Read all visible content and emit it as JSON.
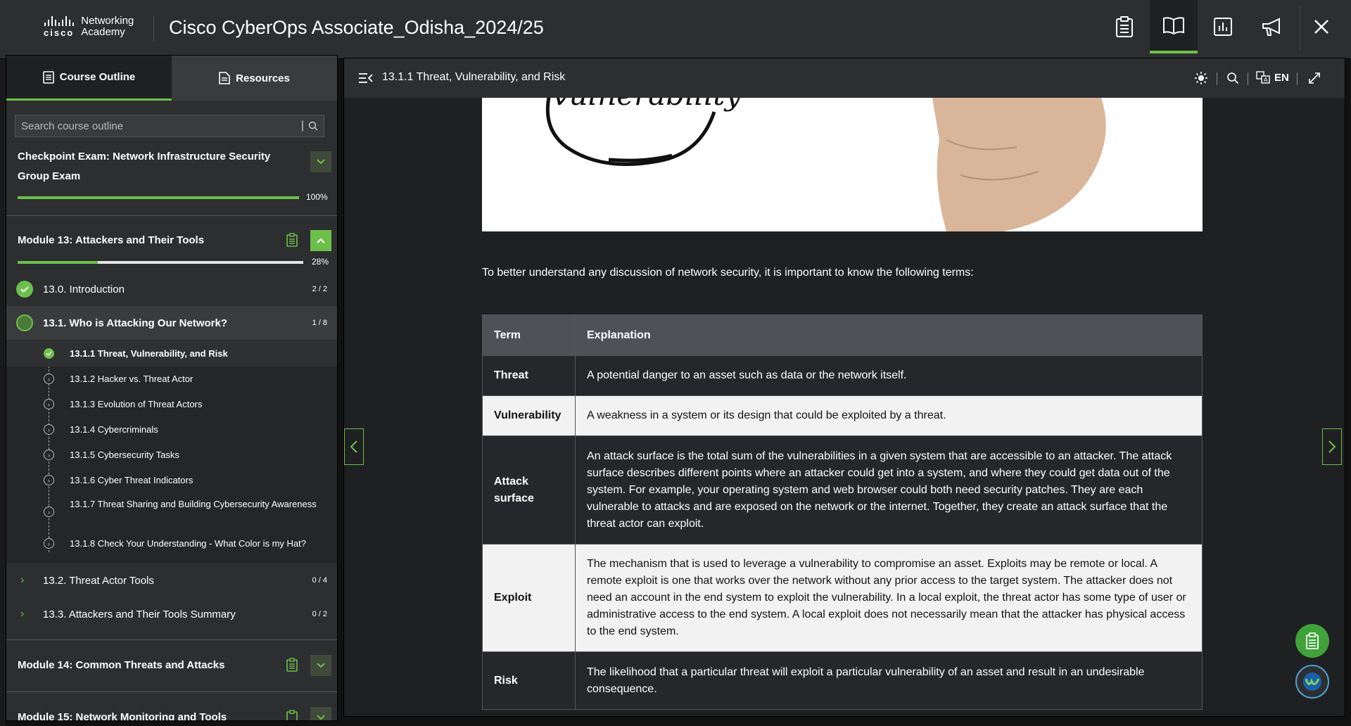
{
  "header": {
    "logo_brand": "cisco",
    "logo_line1": "Networking",
    "logo_line2": "Academy",
    "title": "Cisco CyberOps Associate_Odisha_2024/25",
    "buttons": [
      "clipboard-icon",
      "book-icon",
      "chart-icon",
      "megaphone-icon",
      "close-icon"
    ]
  },
  "sidebar": {
    "tabs": [
      {
        "label": "Course Outline",
        "active": true
      },
      {
        "label": "Resources",
        "active": false
      }
    ],
    "search_placeholder": "Search course outline",
    "exam": {
      "title": "Checkpoint Exam: Network Infrastructure Security Group Exam",
      "progress": 1.0,
      "progress_label": "100%"
    },
    "module13": {
      "title": "Module 13: Attackers and Their Tools",
      "progress": 0.28,
      "progress_label": "28%"
    },
    "topics": [
      {
        "label": "13.0. Introduction",
        "count": "2 / 2",
        "status": "done"
      },
      {
        "label": "13.1. Who is Attacking Our Network?",
        "count": "1 / 8",
        "status": "in-progress"
      },
      {
        "label": "13.2. Threat Actor Tools",
        "count": "0 / 4",
        "status": "collapsed"
      },
      {
        "label": "13.3. Attackers and Their Tools Summary",
        "count": "0 / 2",
        "status": "collapsed"
      }
    ],
    "subtopics": [
      {
        "label": "13.1.1 Threat, Vulnerability, and Risk",
        "done": true
      },
      {
        "label": "13.1.2 Hacker vs. Threat Actor",
        "done": false
      },
      {
        "label": "13.1.3 Evolution of Threat Actors",
        "done": false
      },
      {
        "label": "13.1.4 Cybercriminals",
        "done": false
      },
      {
        "label": "13.1.5 Cybersecurity Tasks",
        "done": false
      },
      {
        "label": "13.1.6 Cyber Threat Indicators",
        "done": false
      },
      {
        "label": "13.1.7 Threat Sharing and Building Cybersecurity Awareness",
        "done": false
      },
      {
        "label": "13.1.8 Check Your Understanding - What Color is my Hat?",
        "done": false
      }
    ],
    "module14": {
      "title": "Module 14: Common Threats and Attacks"
    },
    "module15": {
      "title": "Module 15: Network Monitoring and Tools"
    }
  },
  "content": {
    "page_title": "13.1.1 Threat, Vulnerability, and Risk",
    "language": "EN",
    "image_text": "vulnerability",
    "intro": "To better understand any discussion of network security, it is important to know the following terms:",
    "table": {
      "headers": [
        "Term",
        "Explanation"
      ],
      "rows": [
        {
          "term": "Threat",
          "explanation": "A potential danger to an asset such as data or the network itself."
        },
        {
          "term": "Vulnerability",
          "explanation": "A weakness in a system or its design that could be exploited by a threat."
        },
        {
          "term": "Attack surface",
          "explanation": "An attack surface is the total sum of the vulnerabilities in a given system that are accessible to an attacker. The attack surface describes different points where an attacker could get into a system, and where they could get data out of the system. For example, your operating system and web browser could both need security patches. They are each vulnerable to attacks and are exposed on the network or the internet. Together, they create an attack surface that the threat actor can exploit."
        },
        {
          "term": "Exploit",
          "explanation": "The mechanism that is used to leverage a vulnerability to compromise an asset. Exploits may be remote or local. A remote exploit is one that works over the network without any prior access to the target system. The attacker does not need an account in the end system to exploit the vulnerability. In a local exploit, the threat actor has some type of user or administrative access to the end system. A local exploit does not necessarily mean that the attacker has physical access to the end system."
        },
        {
          "term": "Risk",
          "explanation": "The likelihood that a particular threat will exploit a particular vulnerability of an asset and result in an undesirable consequence."
        }
      ]
    }
  },
  "colors": {
    "accent": "#6cc04a",
    "header_bg": "#2d2e30",
    "content_bg": "#1f2022"
  }
}
